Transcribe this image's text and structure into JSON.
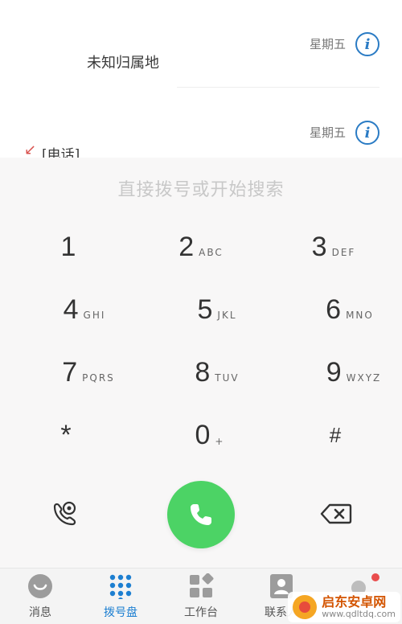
{
  "call_log": [
    {
      "name": "未知归属地",
      "day": "星期五",
      "type": "outgoing"
    },
    {
      "name": "[电话]",
      "day": "星期五",
      "type": "missed"
    }
  ],
  "dialer": {
    "placeholder": "直接拨号或开始搜索",
    "keys": [
      {
        "digit": "1",
        "letters": ""
      },
      {
        "digit": "2",
        "letters": "ABC"
      },
      {
        "digit": "3",
        "letters": "DEF"
      },
      {
        "digit": "4",
        "letters": "GHI"
      },
      {
        "digit": "5",
        "letters": "JKL"
      },
      {
        "digit": "6",
        "letters": "MNO"
      },
      {
        "digit": "7",
        "letters": "PQRS"
      },
      {
        "digit": "8",
        "letters": "TUV"
      },
      {
        "digit": "9",
        "letters": "WXYZ"
      },
      {
        "digit": "*",
        "letters": ""
      },
      {
        "digit": "0",
        "letters": "+"
      },
      {
        "digit": "#",
        "letters": ""
      }
    ]
  },
  "tabs": [
    {
      "label": "消息",
      "icon": "smile-chat-icon",
      "active": false
    },
    {
      "label": "拨号盘",
      "icon": "dialpad-icon",
      "active": true
    },
    {
      "label": "工作台",
      "icon": "workbench-icon",
      "active": false
    },
    {
      "label": "联系人",
      "icon": "contact-card-icon",
      "active": false
    },
    {
      "label": "",
      "icon": "more-icon",
      "active": false,
      "badge": true
    }
  ],
  "watermark": {
    "title": "启东安卓网",
    "url": "www.qdltdq.com"
  },
  "colors": {
    "call_green": "#4cd365",
    "accent_blue": "#1d7fd1",
    "info_blue": "#2a7bc4",
    "missed_red": "#d9534f"
  }
}
